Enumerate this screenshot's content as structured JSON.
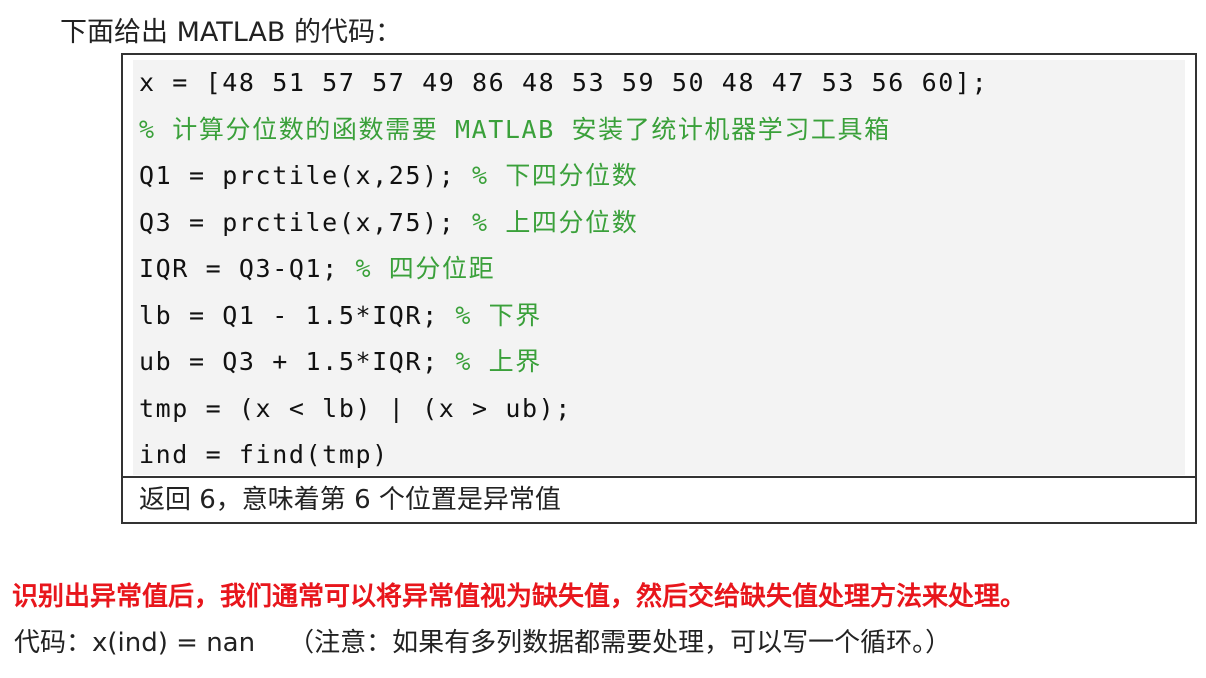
{
  "intro": "下面给出 MATLAB 的代码：",
  "code": [
    {
      "code": "x = [48 51 57 57 49 86 48 53 59 50 48 47 53 56 60];",
      "comment": ""
    },
    {
      "code": "",
      "comment": "% 计算分位数的函数需要 MATLAB 安装了统计机器学习工具箱"
    },
    {
      "code": "Q1 = prctile(x,25); ",
      "comment": "% 下四分位数"
    },
    {
      "code": "Q3 = prctile(x,75); ",
      "comment": "% 上四分位数"
    },
    {
      "code": "IQR = Q3-Q1; ",
      "comment": "% 四分位距"
    },
    {
      "code": "lb = Q1 - 1.5*IQR; ",
      "comment": "% 下界"
    },
    {
      "code": "ub = Q3 + 1.5*IQR; ",
      "comment": "% 上界"
    },
    {
      "code": "tmp = (x < lb) | (x > ub);",
      "comment": ""
    },
    {
      "code": "ind = find(tmp)",
      "comment": ""
    }
  ],
  "result": "返回 6，意味着第 6 个位置是异常值",
  "highlight": "识别出异常值后，我们通常可以将异常值视为缺失值，然后交给缺失值处理方法来处理。",
  "footer": "代码：x(ind) = nan    （注意：如果有多列数据都需要处理，可以写一个循环。）"
}
